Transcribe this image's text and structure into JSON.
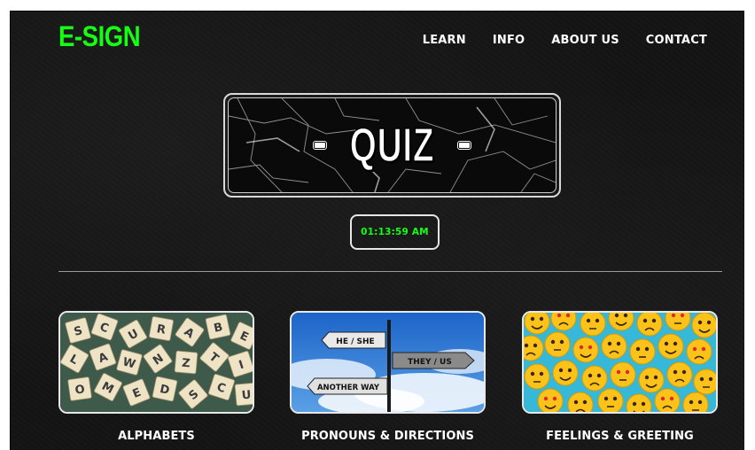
{
  "brand": {
    "logo_text": "E-SIGN",
    "accent_color": "#14ff14"
  },
  "nav": {
    "items": [
      {
        "label": "LEARN"
      },
      {
        "label": "INFO"
      },
      {
        "label": "ABOUT US"
      },
      {
        "label": "CONTACT"
      }
    ]
  },
  "hero": {
    "title": "QUIZ"
  },
  "clock": {
    "time": "01:13:59 AM"
  },
  "categories": [
    {
      "label": "ALPHABETS",
      "image": "scrabble-tiles"
    },
    {
      "label": "PRONOUNS & DIRECTIONS",
      "image": "signpost"
    },
    {
      "label": "FEELINGS & GREETING",
      "image": "emoji-faces"
    }
  ],
  "signpost": {
    "signs": [
      "HE / SHE",
      "THEY / US",
      "ANOTHER WAY"
    ]
  },
  "tiles": {
    "letters": [
      "S",
      "C",
      "U",
      "R",
      "A",
      "B",
      "E",
      "L",
      "A",
      "W",
      "N",
      "Z",
      "T",
      "I",
      "O",
      "M",
      "E",
      "D"
    ]
  }
}
